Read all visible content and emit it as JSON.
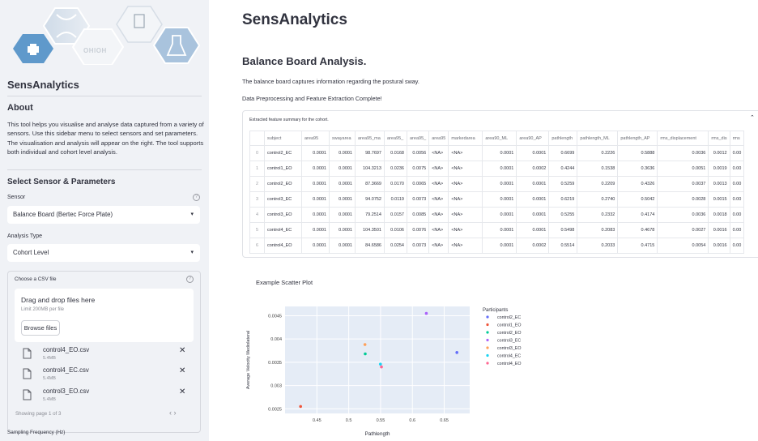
{
  "sidebar": {
    "logo_text": "OHIOH",
    "app_title": "SensAnalytics",
    "about_heading": "About",
    "about_text": "This tool helps you visualise and analyse data captured from a variety of sensors. Use this sidebar menu to select sensors and set parameters. The visualisation and analysis will appear on the right. The tool supports both individual and cohort level analysis.",
    "section_heading": "Select Sensor & Parameters",
    "sensor_label": "Sensor",
    "sensor_value": "Balance Board (Bertec Force Plate)",
    "analysis_label": "Analysis Type",
    "analysis_value": "Cohort Level",
    "uploader_label": "Choose a CSV file",
    "drop_title": "Drag and drop files here",
    "drop_limit": "Limit 200MB per file",
    "browse_label": "Browse files",
    "files": [
      {
        "name": "control4_EO.csv",
        "size": "5.4MB"
      },
      {
        "name": "control4_EC.csv",
        "size": "5.4MB"
      },
      {
        "name": "control3_EO.csv",
        "size": "5.4MB"
      }
    ],
    "paging_text": "Showing page 1 of 3",
    "paging_arrows": "‹  ›",
    "sampling_label": "Sampling Frequency (Hz)",
    "help_glyph": "?",
    "caret_glyph": "▾",
    "delete_glyph": "✕"
  },
  "main": {
    "title": "SensAnalytics",
    "subtitle": "Balance Board Analysis.",
    "p1": "The balance board captures information regarding the postural sway.",
    "p2": "Data Preprocessing and Feature Extraction Complete!",
    "expander_label": "Extracted feature summary for the cohort.",
    "expander_chevron": "⌃",
    "table": {
      "columns": [
        "",
        "subject",
        "area95",
        "swayarea",
        "area95_ma",
        "area95_",
        "area95_",
        "area95",
        "markedarea",
        "area90_ML",
        "area90_AP",
        "pathlength",
        "pathlength_ML",
        "pathlength_AP",
        "rms_displacement",
        "rms_dis",
        "rms"
      ],
      "rows": [
        [
          "0",
          "control2_EC",
          "0.0001",
          "0.0001",
          "98.7697",
          "0.0168",
          "0.0056",
          "<NA>",
          "<NA>",
          "0.0001",
          "0.0001",
          "0.6699",
          "0.2226",
          "0.5888",
          "0.0036",
          "0.0012",
          "0.00"
        ],
        [
          "1",
          "control1_EO",
          "0.0001",
          "0.0001",
          "104.3213",
          "0.0236",
          "0.0075",
          "<NA>",
          "<NA>",
          "0.0001",
          "0.0002",
          "0.4244",
          "0.1538",
          "0.3636",
          "0.0051",
          "0.0019",
          "0.00"
        ],
        [
          "2",
          "control2_EO",
          "0.0001",
          "0.0001",
          "87.3669",
          "0.0170",
          "0.0065",
          "<NA>",
          "<NA>",
          "0.0001",
          "0.0001",
          "0.5259",
          "0.2209",
          "0.4326",
          "0.0037",
          "0.0013",
          "0.00"
        ],
        [
          "3",
          "control3_EC",
          "0.0001",
          "0.0001",
          "94.0752",
          "0.0119",
          "0.0073",
          "<NA>",
          "<NA>",
          "0.0001",
          "0.0001",
          "0.6219",
          "0.2740",
          "0.5042",
          "0.0028",
          "0.0015",
          "0.00"
        ],
        [
          "4",
          "control3_EO",
          "0.0001",
          "0.0001",
          "79.2514",
          "0.0157",
          "0.0085",
          "<NA>",
          "<NA>",
          "0.0001",
          "0.0001",
          "0.5255",
          "0.2332",
          "0.4174",
          "0.0036",
          "0.0018",
          "0.00"
        ],
        [
          "5",
          "control4_EC",
          "0.0001",
          "0.0001",
          "104.3501",
          "0.0106",
          "0.0076",
          "<NA>",
          "<NA>",
          "0.0001",
          "0.0001",
          "0.5498",
          "0.2083",
          "0.4678",
          "0.0027",
          "0.0016",
          "0.00"
        ],
        [
          "6",
          "control4_EO",
          "0.0001",
          "0.0001",
          "84.6586",
          "0.0254",
          "0.0073",
          "<NA>",
          "<NA>",
          "0.0001",
          "0.0002",
          "0.5514",
          "0.2033",
          "0.4715",
          "0.0054",
          "0.0016",
          "0.00"
        ]
      ]
    },
    "chart_heading": "Example Scatter Plot"
  },
  "colors": {
    "sidebar_bg": "#f0f2f6",
    "plot_bg": "#e5ecf6",
    "text": "#31333f"
  },
  "chart_data": {
    "type": "scatter",
    "xlabel": "Pathlength",
    "ylabel": "Average Velocity Mediolateral",
    "legend_title": "Participants",
    "legend_placement": "right",
    "xlim": [
      0.4,
      0.69
    ],
    "ylim": [
      0.0024,
      0.0047
    ],
    "x_ticks": [
      0.45,
      0.5,
      0.55,
      0.6,
      0.65
    ],
    "x_tick_labels": [
      "0.45",
      "0.5",
      "0.55",
      "0.6",
      "0.65"
    ],
    "y_ticks": [
      0.0025,
      0.003,
      0.0035,
      0.004,
      0.0045
    ],
    "y_tick_labels": [
      "0.0025",
      "0.003",
      "0.0035",
      "0.004",
      "0.0045"
    ],
    "grid": true,
    "series": [
      {
        "name": "control2_EC",
        "color": "#636efa",
        "x": [
          0.6699
        ],
        "y": [
          0.00371
        ]
      },
      {
        "name": "control1_EO",
        "color": "#ef553b",
        "x": [
          0.4244
        ],
        "y": [
          0.00255
        ]
      },
      {
        "name": "control2_EO",
        "color": "#00cc96",
        "x": [
          0.5259
        ],
        "y": [
          0.00368
        ]
      },
      {
        "name": "control3_EC",
        "color": "#ab63fa",
        "x": [
          0.6219
        ],
        "y": [
          0.00455
        ]
      },
      {
        "name": "control3_EO",
        "color": "#ffa15a",
        "x": [
          0.5255
        ],
        "y": [
          0.00388
        ]
      },
      {
        "name": "control4_EC",
        "color": "#19d3f3",
        "x": [
          0.5498
        ],
        "y": [
          0.00346
        ]
      },
      {
        "name": "control4_EO",
        "color": "#ff6692",
        "x": [
          0.5514
        ],
        "y": [
          0.0034
        ]
      }
    ]
  }
}
